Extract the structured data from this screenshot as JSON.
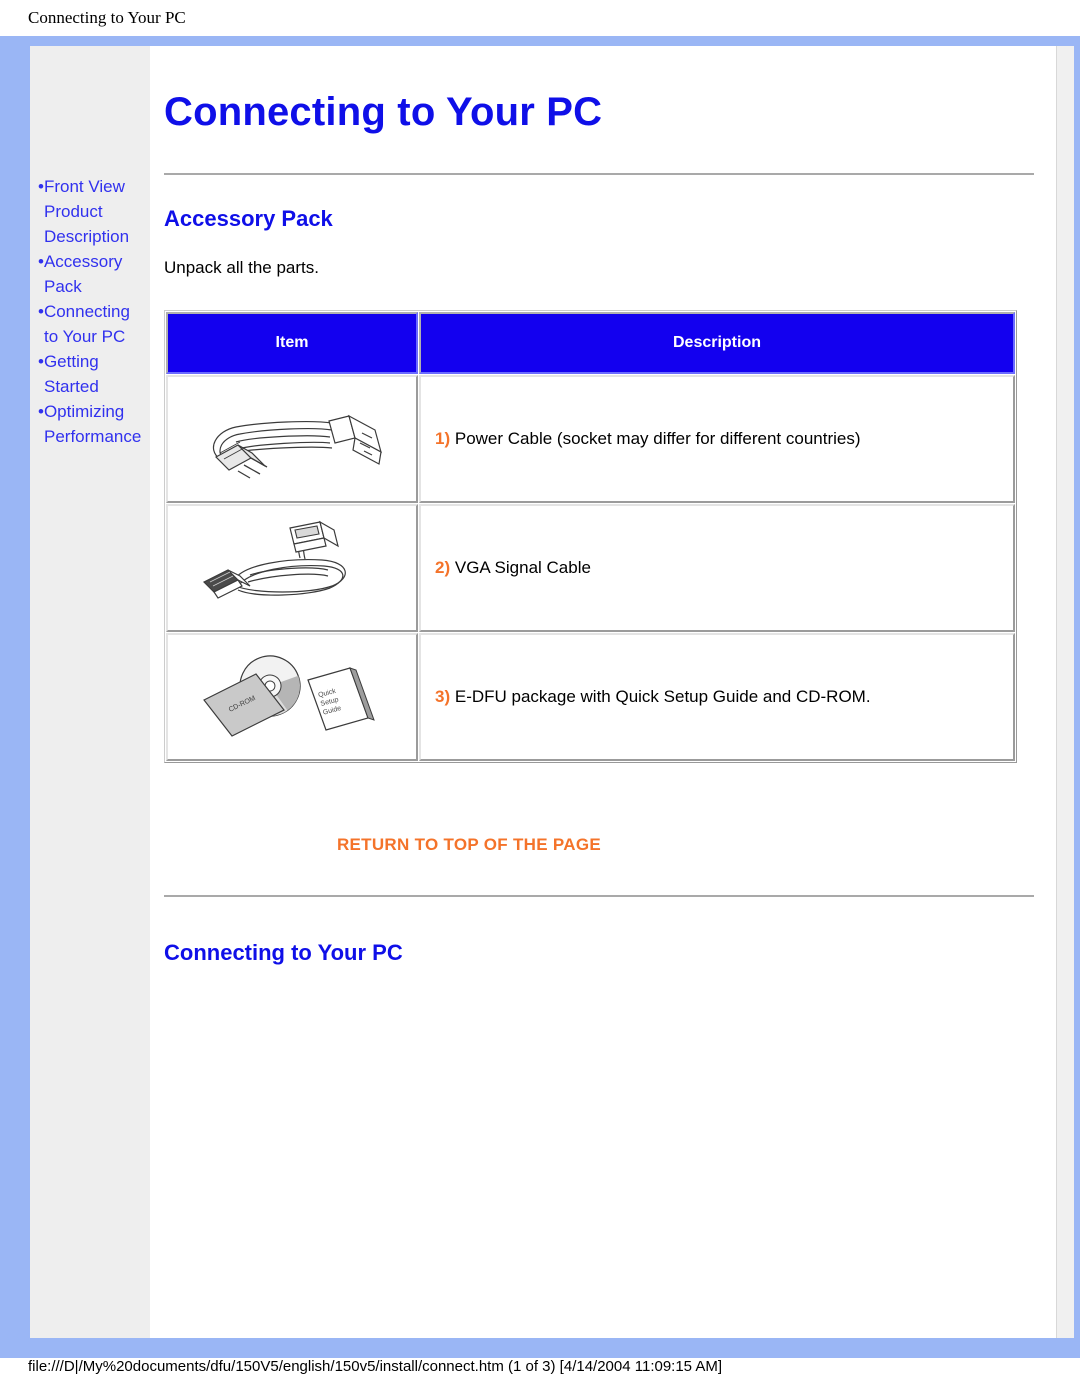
{
  "print_header": {
    "title": "Connecting to Your PC"
  },
  "print_footer": {
    "path": "file:///D|/My%20documents/dfu/150V5/english/150v5/install/connect.htm (1 of 3) [4/14/2004 11:09:15 AM]"
  },
  "page": {
    "title": "Connecting to Your PC"
  },
  "sidebar": {
    "items": [
      {
        "bullet": "•",
        "label": "Front View Product Description"
      },
      {
        "bullet": "•",
        "label": "Accessory Pack"
      },
      {
        "bullet": "•",
        "label": "Connecting to Your PC"
      },
      {
        "bullet": "•",
        "label": "Getting Started"
      },
      {
        "bullet": "•",
        "label": "Optimizing Performance"
      }
    ]
  },
  "accessory_section": {
    "heading": "Accessory Pack",
    "intro": "Unpack all the parts.",
    "table": {
      "headers": [
        "Item",
        "Description"
      ],
      "rows": [
        {
          "num": "1)",
          "image": "power-cable-illustration",
          "description": "Power Cable (socket may differ for different countries)"
        },
        {
          "num": "2)",
          "image": "vga-signal-cable-illustration",
          "description": "VGA Signal Cable"
        },
        {
          "num": "3)",
          "image": "edfu-cdrom-package-illustration",
          "description": "E-DFU package with Quick Setup Guide and CD-ROM."
        }
      ]
    },
    "cd_label": "CD-ROM",
    "guide_label": [
      "Quick",
      "Setup",
      "Guide"
    ]
  },
  "return_top_link": "RETURN TO TOP OF THE PAGE",
  "connecting_section": {
    "heading": "Connecting to Your PC"
  },
  "colors": {
    "frame_blue": "#9ab6f5",
    "link_blue": "#3131ee",
    "heading_blue": "#0f0fe8",
    "table_header_blue": "#1300ef",
    "accent_orange": "#f4732a",
    "sidebar_grey": "#eeeeee"
  }
}
